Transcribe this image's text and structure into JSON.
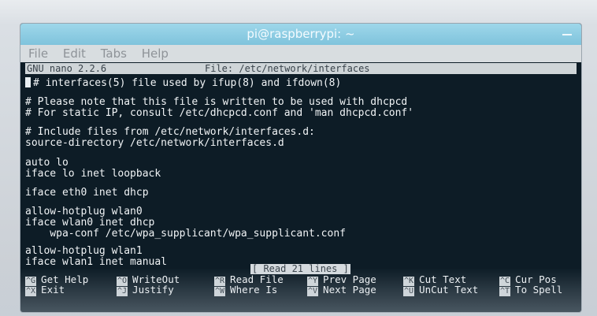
{
  "window": {
    "title": "pi@raspberrypi: ~"
  },
  "menubar": {
    "items": [
      "File",
      "Edit",
      "Tabs",
      "Help"
    ]
  },
  "nano": {
    "version": "GNU nano 2.2.6",
    "file_label": "File: /etc/network/interfaces",
    "lines": [
      "# interfaces(5) file used by ifup(8) and ifdown(8)",
      "",
      "# Please note that this file is written to be used with dhcpcd",
      "# For static IP, consult /etc/dhcpcd.conf and 'man dhcpcd.conf'",
      "",
      "# Include files from /etc/network/interfaces.d:",
      "source-directory /etc/network/interfaces.d",
      "",
      "auto lo",
      "iface lo inet loopback",
      "",
      "iface eth0 inet dhcp",
      "",
      "allow-hotplug wlan0",
      "iface wlan0 inet dhcp",
      "    wpa-conf /etc/wpa_supplicant/wpa_supplicant.conf",
      "",
      "allow-hotplug wlan1",
      "iface wlan1 inet manual"
    ],
    "status": "[ Read 21 lines ]",
    "shortcuts": [
      {
        "key": "^G",
        "label": "Get Help"
      },
      {
        "key": "^O",
        "label": "WriteOut"
      },
      {
        "key": "^R",
        "label": "Read File"
      },
      {
        "key": "^Y",
        "label": "Prev Page"
      },
      {
        "key": "^K",
        "label": "Cut Text"
      },
      {
        "key": "^C",
        "label": "Cur Pos"
      },
      {
        "key": "^X",
        "label": "Exit"
      },
      {
        "key": "^J",
        "label": "Justify"
      },
      {
        "key": "^W",
        "label": "Where Is"
      },
      {
        "key": "^V",
        "label": "Next Page"
      },
      {
        "key": "^U",
        "label": "UnCut Text"
      },
      {
        "key": "^T",
        "label": "To Spell"
      }
    ]
  }
}
